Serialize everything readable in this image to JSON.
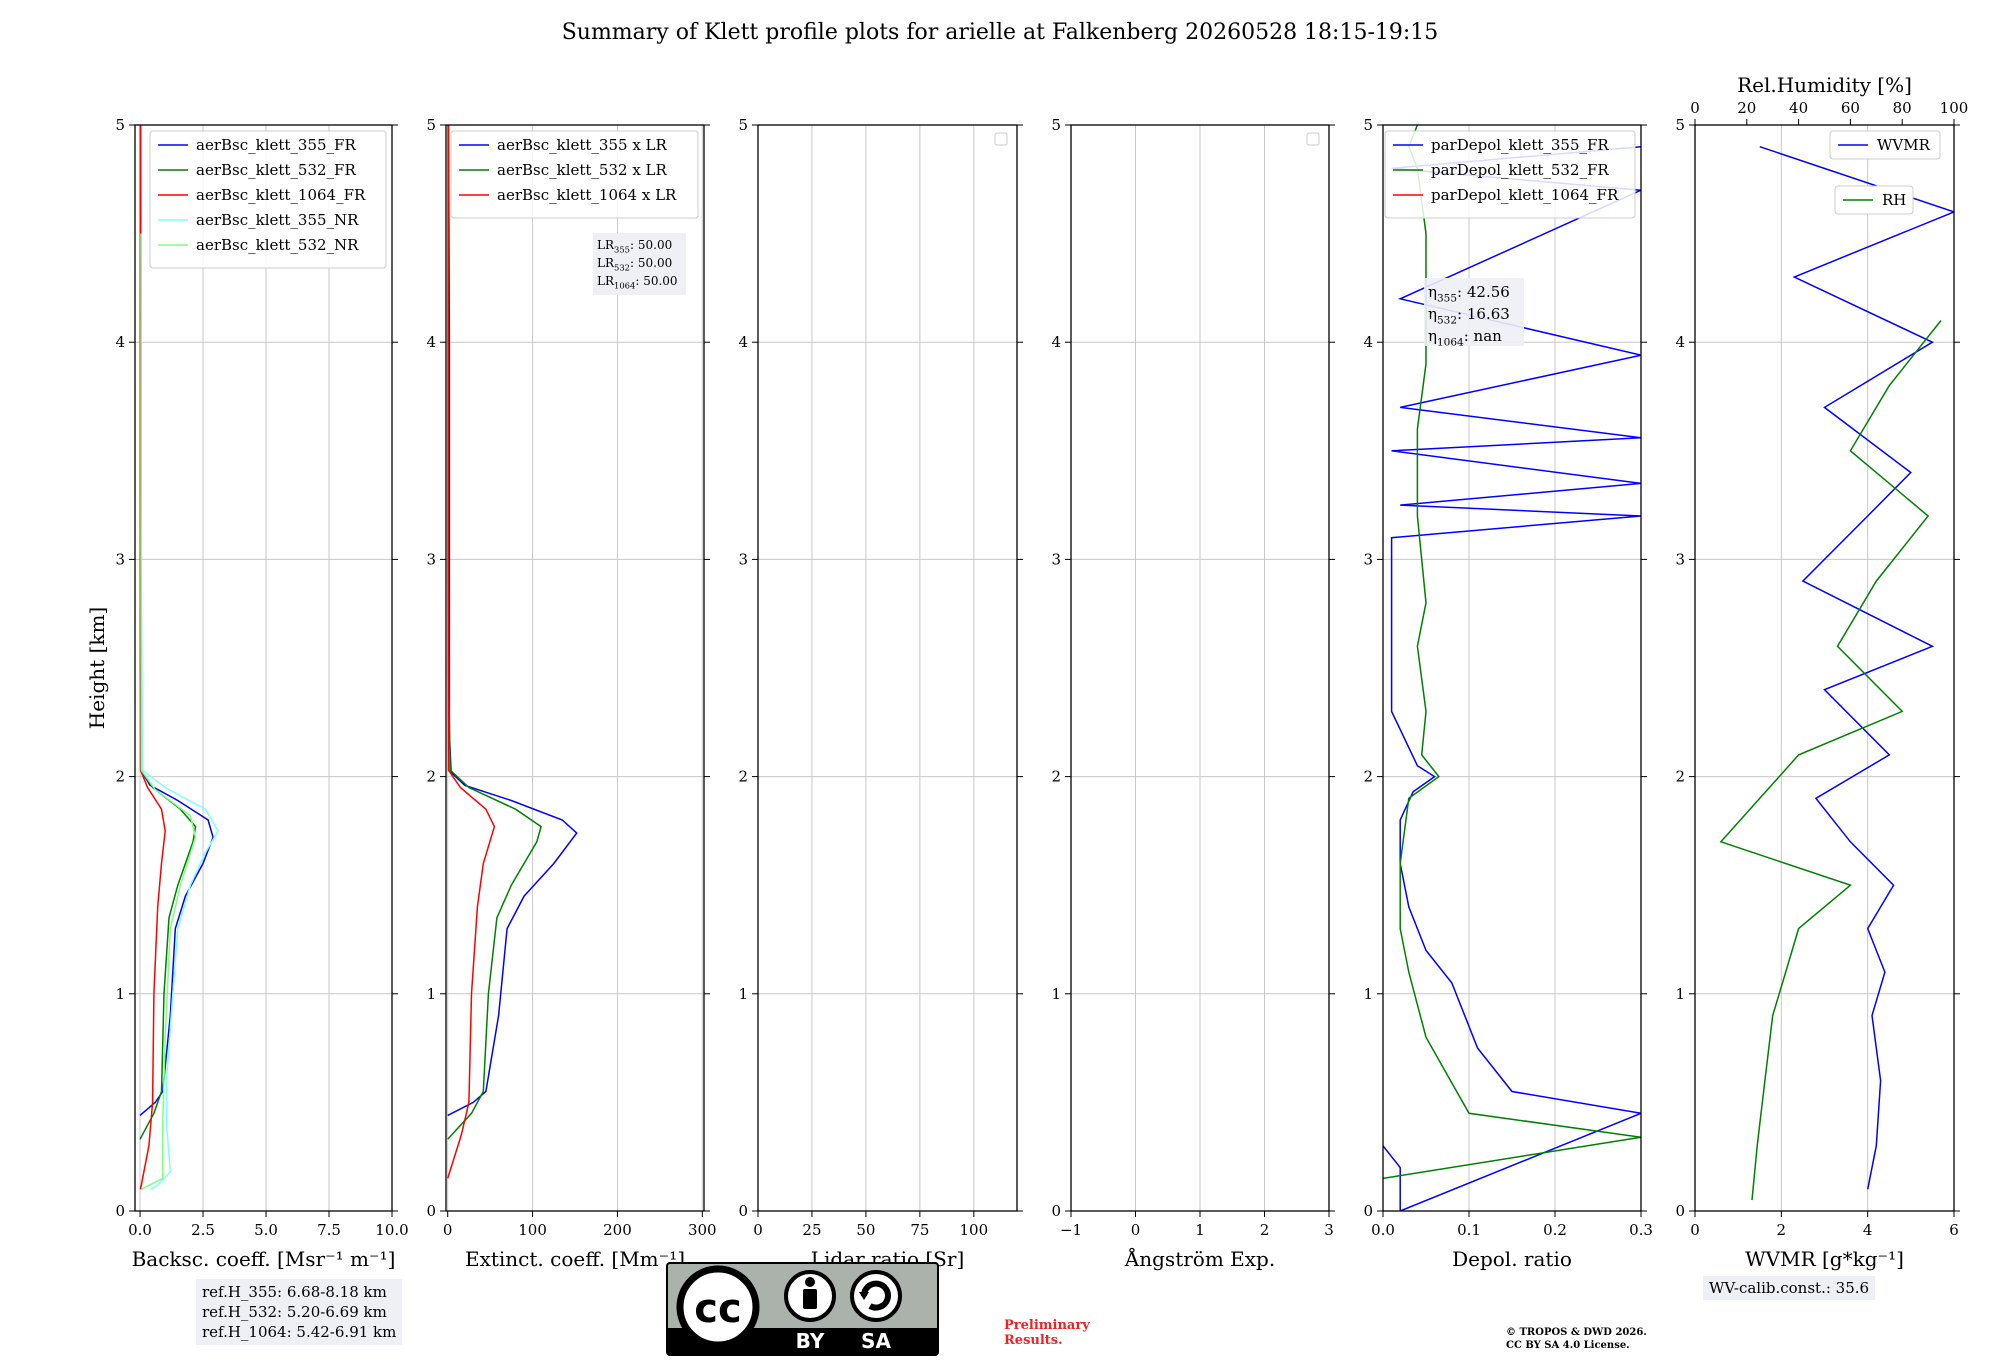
{
  "page": {
    "title": "Summary of Klett profile plots for arielle at Falkenberg 20260528 18:15-19:15",
    "ref_heights": [
      "ref.H_355: 6.68-8.18 km",
      "ref.H_532: 5.20-6.69 km",
      "ref.H_1064: 5.42-6.91 km"
    ],
    "wv_calib": "WV-calib.const.: 35.6",
    "preliminary": [
      "Preliminary",
      "Results."
    ],
    "copyright": [
      "© TROPOS & DWD 2026.",
      "CC BY SA 4.0 License."
    ],
    "license_badge": {
      "top_left": "cc",
      "labels": [
        "BY",
        "SA"
      ]
    }
  },
  "chart_data": [
    {
      "type": "line",
      "xlabel": "Backsc. coeff. [Msr⁻¹ m⁻¹]",
      "ylabel": "Height [km]",
      "xlim": [
        -0.2,
        10
      ],
      "ylim": [
        0,
        5
      ],
      "xticks": [
        "0.0",
        "2.5",
        "5.0",
        "7.5",
        "10.0"
      ],
      "xtick_values": [
        0,
        2.5,
        5,
        7.5,
        10
      ],
      "yticks": [
        0,
        1,
        2,
        3,
        4,
        5
      ],
      "grid": true,
      "legend": "top-right",
      "series": [
        {
          "name": "aerBsc_klett_355_FR",
          "color": "#0000ff",
          "points": [
            [
              0,
              0.44
            ],
            [
              0.6,
              0.5
            ],
            [
              0.9,
              0.55
            ],
            [
              1.2,
              0.9
            ],
            [
              1.4,
              1.3
            ],
            [
              1.8,
              1.45
            ],
            [
              2.5,
              1.6
            ],
            [
              2.9,
              1.72
            ],
            [
              2.7,
              1.8
            ],
            [
              1.5,
              1.89
            ],
            [
              0.4,
              1.96
            ],
            [
              0.08,
              2.02
            ],
            [
              0.03,
              2.2
            ],
            [
              0.04,
              3.0
            ],
            [
              0.03,
              4.0
            ],
            [
              0.02,
              4.8
            ],
            [
              0.02,
              5.0
            ]
          ]
        },
        {
          "name": "aerBsc_klett_532_FR",
          "color": "#008000",
          "points": [
            [
              0,
              0.33
            ],
            [
              0.55,
              0.45
            ],
            [
              0.85,
              0.55
            ],
            [
              0.95,
              1.0
            ],
            [
              1.15,
              1.35
            ],
            [
              1.5,
              1.5
            ],
            [
              2.1,
              1.7
            ],
            [
              2.2,
              1.77
            ],
            [
              1.6,
              1.85
            ],
            [
              0.5,
              1.95
            ],
            [
              0.05,
              2.03
            ],
            [
              0.02,
              2.5
            ],
            [
              0.02,
              4.0
            ],
            [
              0.02,
              5.0
            ]
          ]
        },
        {
          "name": "aerBsc_klett_1064_FR",
          "color": "#ff0000",
          "points": [
            [
              0.02,
              0.1
            ],
            [
              0.35,
              0.3
            ],
            [
              0.5,
              0.5
            ],
            [
              0.55,
              1.0
            ],
            [
              0.7,
              1.4
            ],
            [
              0.85,
              1.6
            ],
            [
              1.0,
              1.75
            ],
            [
              0.85,
              1.85
            ],
            [
              0.3,
              1.95
            ],
            [
              0.02,
              2.03
            ],
            [
              0.01,
              3.0
            ],
            [
              0.01,
              5.0
            ]
          ]
        },
        {
          "name": "aerBsc_klett_355_NR",
          "color": "#7fffff",
          "points": [
            [
              0.4,
              0.1
            ],
            [
              0.7,
              0.12
            ],
            [
              1.2,
              0.18
            ],
            [
              1.05,
              0.4
            ],
            [
              1.05,
              0.6
            ],
            [
              1.3,
              1.0
            ],
            [
              1.5,
              1.3
            ],
            [
              2.0,
              1.5
            ],
            [
              2.6,
              1.65
            ],
            [
              3.1,
              1.75
            ],
            [
              2.6,
              1.85
            ],
            [
              1.0,
              1.95
            ],
            [
              0.1,
              2.03
            ],
            [
              0.05,
              3.0
            ],
            [
              0.04,
              4.5
            ]
          ]
        },
        {
          "name": "aerBsc_klett_532_NR",
          "color": "#80ff80",
          "points": [
            [
              0.05,
              0.1
            ],
            [
              0.9,
              0.15
            ],
            [
              0.9,
              0.4
            ],
            [
              1.0,
              0.8
            ],
            [
              1.2,
              1.3
            ],
            [
              1.6,
              1.5
            ],
            [
              2.2,
              1.72
            ],
            [
              2.0,
              1.82
            ],
            [
              0.6,
              1.94
            ],
            [
              0.05,
              2.03
            ],
            [
              0.04,
              3.0
            ],
            [
              0.05,
              4.5
            ]
          ]
        }
      ]
    },
    {
      "type": "line",
      "xlabel": "Extinct. coeff. [Mm⁻¹]",
      "xlim": [
        -2,
        302
      ],
      "ylim": [
        0,
        5
      ],
      "xticks": [
        "0",
        "100",
        "200",
        "300"
      ],
      "xtick_values": [
        0,
        100,
        200,
        300
      ],
      "yticks": [
        0,
        1,
        2,
        3,
        4,
        5
      ],
      "grid": true,
      "legend": "top-right",
      "lidar_ratios": [
        {
          "label": "LR",
          "sub": "355",
          "value": ": 50.00"
        },
        {
          "label": "LR",
          "sub": "532",
          "value": ": 50.00"
        },
        {
          "label": "LR",
          "sub": "1064",
          "value": ": 50.00"
        }
      ],
      "series": [
        {
          "name": "aerBsc_klett_355 x LR",
          "color": "#0000ff",
          "points": [
            [
              0,
              0.44
            ],
            [
              30,
              0.5
            ],
            [
              45,
              0.55
            ],
            [
              60,
              0.9
            ],
            [
              70,
              1.3
            ],
            [
              90,
              1.45
            ],
            [
              125,
              1.6
            ],
            [
              152,
              1.74
            ],
            [
              135,
              1.8
            ],
            [
              75,
              1.89
            ],
            [
              20,
              1.96
            ],
            [
              4,
              2.02
            ],
            [
              2,
              2.2
            ],
            [
              2,
              3.0
            ],
            [
              2,
              4.0
            ],
            [
              1,
              5.0
            ]
          ]
        },
        {
          "name": "aerBsc_klett_532 x LR",
          "color": "#008000",
          "points": [
            [
              0,
              0.33
            ],
            [
              28,
              0.45
            ],
            [
              42,
              0.55
            ],
            [
              48,
              1.0
            ],
            [
              58,
              1.35
            ],
            [
              75,
              1.5
            ],
            [
              105,
              1.7
            ],
            [
              110,
              1.77
            ],
            [
              80,
              1.85
            ],
            [
              25,
              1.95
            ],
            [
              3,
              2.03
            ],
            [
              1,
              2.5
            ],
            [
              1,
              5.0
            ]
          ]
        },
        {
          "name": "aerBsc_klett_1064 x LR",
          "color": "#ff0000",
          "points": [
            [
              0,
              0.15
            ],
            [
              16,
              0.35
            ],
            [
              25,
              0.5
            ],
            [
              28,
              1.0
            ],
            [
              35,
              1.4
            ],
            [
              42,
              1.6
            ],
            [
              55,
              1.77
            ],
            [
              45,
              1.85
            ],
            [
              15,
              1.95
            ],
            [
              1,
              2.03
            ],
            [
              0.5,
              3.0
            ],
            [
              0.5,
              5.0
            ]
          ]
        }
      ]
    },
    {
      "type": "line",
      "xlabel": "Lidar ratio [Sr]",
      "xlim": [
        0,
        120
      ],
      "ylim": [
        0,
        5
      ],
      "xticks": [
        "0",
        "25",
        "50",
        "75",
        "100"
      ],
      "xtick_values": [
        0,
        25,
        50,
        75,
        100
      ],
      "yticks": [
        0,
        1,
        2,
        3,
        4,
        5
      ],
      "grid": true,
      "legend": "top-right",
      "series": []
    },
    {
      "type": "line",
      "xlabel": "Ångström Exp.",
      "xlim": [
        -1,
        3
      ],
      "ylim": [
        0,
        5
      ],
      "xticks": [
        "−1",
        "0",
        "1",
        "2",
        "3"
      ],
      "xtick_values": [
        -1,
        0,
        1,
        2,
        3
      ],
      "yticks": [
        0,
        1,
        2,
        3,
        4,
        5
      ],
      "grid": true,
      "legend": "top-right",
      "series": []
    },
    {
      "type": "line",
      "xlabel": "Depol. ratio",
      "xlim": [
        0,
        0.3
      ],
      "ylim": [
        0,
        5
      ],
      "xticks": [
        "0.0",
        "0.1",
        "0.2",
        "0.3"
      ],
      "xtick_values": [
        0,
        0.1,
        0.2,
        0.3
      ],
      "yticks": [
        0,
        1,
        2,
        3,
        4,
        5
      ],
      "grid": true,
      "legend": "top-right",
      "depol_annotations": [
        {
          "sym": "η",
          "sub": "355",
          "value": ": 42.56"
        },
        {
          "sym": "η",
          "sub": "532",
          "value": ": 16.63"
        },
        {
          "sym": "η",
          "sub": "1064",
          "value": ": nan"
        }
      ],
      "series": [
        {
          "name": "parDepol_klett_355_FR",
          "color": "#0000ff",
          "points": [
            [
              0.0,
              0.3
            ],
            [
              0.02,
              0.2
            ],
            [
              0.02,
              0.0
            ],
            [
              0.3,
              0.45
            ],
            [
              0.15,
              0.55
            ],
            [
              0.11,
              0.75
            ],
            [
              0.08,
              1.05
            ],
            [
              0.05,
              1.2
            ],
            [
              0.03,
              1.4
            ],
            [
              0.02,
              1.6
            ],
            [
              0.02,
              1.8
            ],
            [
              0.035,
              1.93
            ],
            [
              0.06,
              2.0
            ],
            [
              0.04,
              2.05
            ],
            [
              0.01,
              2.3
            ],
            [
              0.01,
              2.7
            ],
            [
              0.01,
              3.1
            ],
            [
              0.3,
              3.2
            ],
            [
              0.02,
              3.25
            ],
            [
              0.3,
              3.35
            ],
            [
              0.01,
              3.5
            ],
            [
              0.3,
              3.56
            ],
            [
              0.02,
              3.7
            ],
            [
              0.3,
              3.94
            ],
            [
              0.02,
              4.2
            ],
            [
              0.3,
              4.7
            ],
            [
              0.01,
              4.8
            ],
            [
              0.3,
              4.9
            ]
          ]
        },
        {
          "name": "parDepol_klett_532_FR",
          "color": "#008000",
          "points": [
            [
              0.0,
              0.15
            ],
            [
              0.3,
              0.34
            ],
            [
              0.1,
              0.45
            ],
            [
              0.05,
              0.8
            ],
            [
              0.03,
              1.1
            ],
            [
              0.02,
              1.3
            ],
            [
              0.02,
              1.6
            ],
            [
              0.03,
              1.9
            ],
            [
              0.065,
              2.0
            ],
            [
              0.045,
              2.1
            ],
            [
              0.05,
              2.3
            ],
            [
              0.04,
              2.6
            ],
            [
              0.05,
              2.8
            ],
            [
              0.04,
              3.2
            ],
            [
              0.04,
              3.6
            ],
            [
              0.05,
              3.9
            ],
            [
              0.05,
              4.3
            ],
            [
              0.05,
              4.5
            ],
            [
              0.04,
              4.8
            ],
            [
              0.03,
              4.9
            ],
            [
              0.04,
              5.0
            ]
          ]
        },
        {
          "name": "parDepol_klett_1064_FR",
          "color": "#ff0000",
          "points": []
        }
      ]
    },
    {
      "type": "line",
      "xlabel": "WVMR [g*kg⁻¹]",
      "x2label": "Rel.Humidity [%]",
      "xlim": [
        0,
        6
      ],
      "x2lim": [
        0,
        100
      ],
      "ylim": [
        0,
        5
      ],
      "xticks": [
        "0",
        "2",
        "4",
        "6"
      ],
      "xtick_values": [
        0,
        2,
        4,
        6
      ],
      "x2ticks": [
        "0",
        "20",
        "40",
        "60",
        "80",
        "100"
      ],
      "x2tick_values": [
        0,
        20,
        40,
        60,
        80,
        100
      ],
      "yticks": [
        0,
        1,
        2,
        3,
        4,
        5
      ],
      "grid": true,
      "legend": "top-right",
      "series": [
        {
          "name": "WVMR",
          "color": "#0000ff",
          "points": [
            [
              4.0,
              0.1
            ],
            [
              4.2,
              0.3
            ],
            [
              4.3,
              0.6
            ],
            [
              4.1,
              0.9
            ],
            [
              4.4,
              1.1
            ],
            [
              4.0,
              1.3
            ],
            [
              4.6,
              1.5
            ],
            [
              3.6,
              1.7
            ],
            [
              2.8,
              1.9
            ],
            [
              4.5,
              2.1
            ],
            [
              3.0,
              2.4
            ],
            [
              5.5,
              2.6
            ],
            [
              2.5,
              2.9
            ],
            [
              4.0,
              3.2
            ],
            [
              5.0,
              3.4
            ],
            [
              3.0,
              3.7
            ],
            [
              5.5,
              4.0
            ],
            [
              2.3,
              4.3
            ],
            [
              6.0,
              4.6
            ],
            [
              1.5,
              4.9
            ]
          ]
        },
        {
          "name": "RH",
          "color": "#008000",
          "points": [
            [
              22,
              0.05
            ],
            [
              24,
              0.3
            ],
            [
              27,
              0.6
            ],
            [
              30,
              0.9
            ],
            [
              35,
              1.1
            ],
            [
              40,
              1.3
            ],
            [
              60,
              1.5
            ],
            [
              10,
              1.7
            ],
            [
              25,
              1.9
            ],
            [
              40,
              2.1
            ],
            [
              80,
              2.3
            ],
            [
              55,
              2.6
            ],
            [
              70,
              2.9
            ],
            [
              90,
              3.2
            ],
            [
              60,
              3.5
            ],
            [
              75,
              3.8
            ],
            [
              95,
              4.1
            ]
          ]
        }
      ]
    }
  ]
}
